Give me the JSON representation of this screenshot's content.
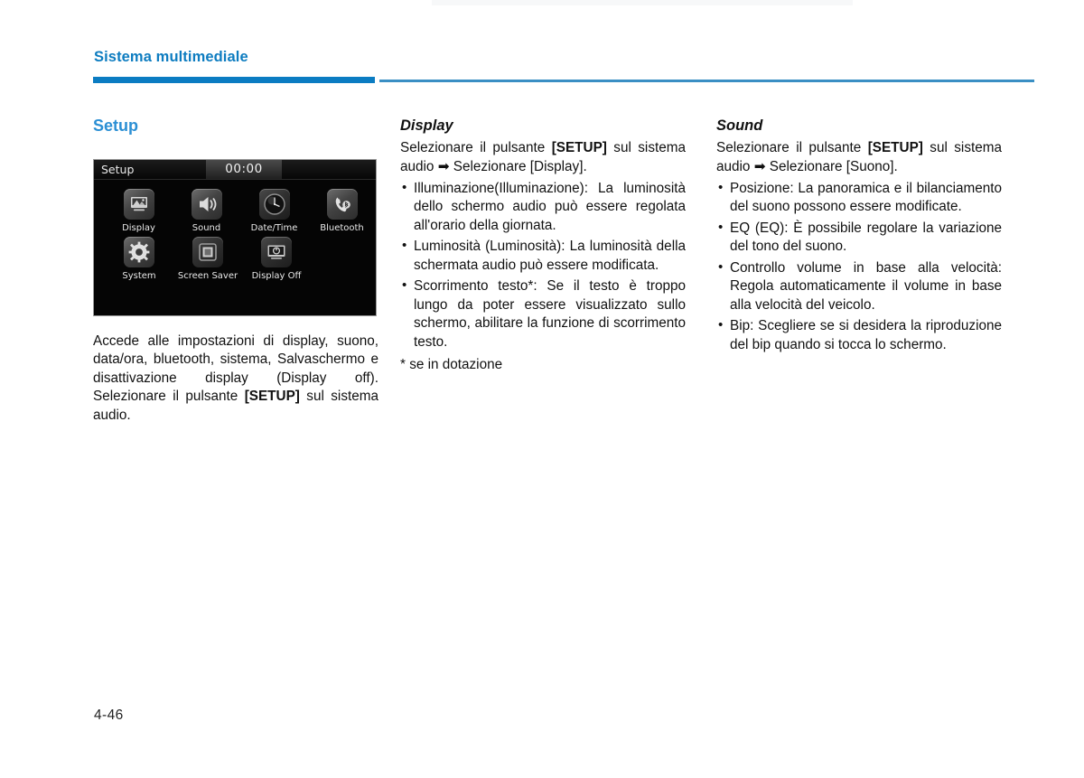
{
  "header": {
    "title": "Sistema multimediale",
    "accent_color": "#0b7cc2"
  },
  "page": {
    "number": "4-46"
  },
  "column_left": {
    "title": "Setup",
    "head_unit": {
      "topbar_title": "Setup",
      "clock": "00:00",
      "row1": [
        {
          "label": "Display",
          "icon": "picture-icon"
        },
        {
          "label": "Sound",
          "icon": "speaker-icon"
        },
        {
          "label": "Date/Time",
          "icon": "clock-icon"
        },
        {
          "label": "Bluetooth",
          "icon": "bluetooth-phone-icon"
        }
      ],
      "row2": [
        {
          "label": "System",
          "icon": "gear-icon"
        },
        {
          "label": "Screen Saver",
          "icon": "screen-saver-icon"
        },
        {
          "label": "Display Off",
          "icon": "display-off-icon"
        }
      ]
    },
    "paragraph_1": "Accede alle impostazioni di display, suono, data/ora, bluetooth, sistema, Salvaschermo e disattivazione display (Display off). Selezionare il pulsante ",
    "paragraph_1_bold": "[SETUP]",
    "paragraph_1_tail": " sul sistema audio."
  },
  "column_middle": {
    "title": "Display",
    "intro_pre": "Selezionare il pulsante ",
    "intro_bold": "[SETUP]",
    "intro_mid": " sul sistema audio ",
    "intro_arrow": "➡",
    "intro_post": " Selezionare [Display].",
    "bullets": [
      "Illuminazione(Illuminazione): La luminosità dello schermo audio può essere regolata all'orario della giornata.",
      "Luminosità (Luminosità): La luminosità della schermata audio può essere modificata.",
      "Scorrimento testo*: Se il testo è troppo lungo da poter essere visualizzato sullo schermo, abilitare la funzione di scorrimento testo."
    ],
    "footnote": "* se in dotazione"
  },
  "column_right": {
    "title": "Sound",
    "intro_pre": "Selezionare il pulsante ",
    "intro_bold": "[SETUP]",
    "intro_mid": " sul sistema audio ",
    "intro_arrow": "➡",
    "intro_post": " Selezionare [Suono].",
    "bullets": [
      "Posizione: La panoramica e il bilanciamento del suono possono essere modificate.",
      "EQ (EQ): È possibile regolare la variazione del tono del suono.",
      "Controllo volume in base alla velocità: Regola automaticamente il volume in base alla velocità del veicolo.",
      "Bip: Scegliere se si desidera la riproduzione del bip quando si tocca lo schermo."
    ]
  }
}
